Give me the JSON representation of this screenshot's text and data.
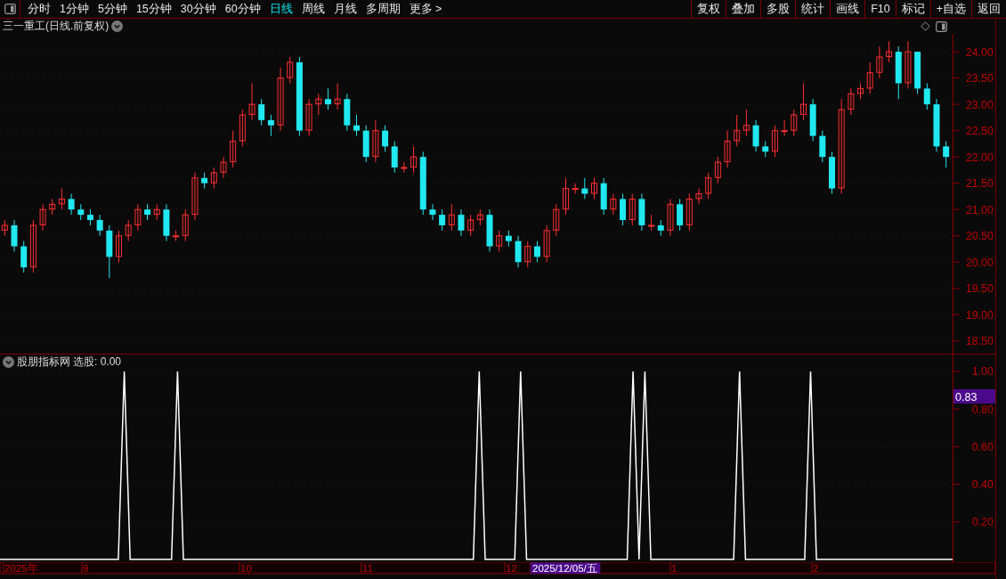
{
  "toolbar": {
    "periods": [
      {
        "label": "分时",
        "selected": false
      },
      {
        "label": "1分钟",
        "selected": false
      },
      {
        "label": "5分钟",
        "selected": false
      },
      {
        "label": "15分钟",
        "selected": false
      },
      {
        "label": "30分钟",
        "selected": false
      },
      {
        "label": "60分钟",
        "selected": false
      },
      {
        "label": "日线",
        "selected": true
      },
      {
        "label": "周线",
        "selected": false
      },
      {
        "label": "月线",
        "selected": false
      },
      {
        "label": "多周期",
        "selected": false
      },
      {
        "label": "更多 >",
        "selected": false
      }
    ],
    "actions": [
      "复权",
      "叠加",
      "多股",
      "统计",
      "画线",
      "F10",
      "标记",
      "+自选",
      "返回"
    ]
  },
  "price_chart": {
    "title": "三一重工(日线.前复权)",
    "chart_data": {
      "type": "candlestick",
      "grid": true,
      "ylim": [
        18.26,
        24.34
      ],
      "yticks": [
        {
          "value": 24,
          "label": "24.00"
        },
        {
          "value": 23.5,
          "label": "23.50"
        },
        {
          "value": 23,
          "label": "23.00"
        },
        {
          "value": 22.5,
          "label": "22.50"
        },
        {
          "value": 22,
          "label": "22.00"
        },
        {
          "value": 21.5,
          "label": "21.50"
        },
        {
          "value": 21,
          "label": "21.00"
        },
        {
          "value": 20.5,
          "label": "20.50"
        },
        {
          "value": 20,
          "label": "20.00"
        },
        {
          "value": 19.5,
          "label": "19.50"
        },
        {
          "value": 19,
          "label": "19.00"
        },
        {
          "value": 18.5,
          "label": "18.50"
        }
      ],
      "ohlc": [
        [
          20.6,
          20.8,
          20.5,
          20.7
        ],
        [
          20.7,
          20.8,
          20.2,
          20.3
        ],
        [
          20.3,
          20.4,
          19.8,
          19.9
        ],
        [
          19.9,
          20.8,
          19.8,
          20.7
        ],
        [
          20.7,
          21.1,
          20.6,
          21.0
        ],
        [
          21.0,
          21.2,
          20.9,
          21.1
        ],
        [
          21.1,
          21.4,
          21.0,
          21.2
        ],
        [
          21.2,
          21.3,
          20.9,
          21.0
        ],
        [
          21.0,
          21.1,
          20.8,
          20.9
        ],
        [
          20.9,
          21.0,
          20.7,
          20.8
        ],
        [
          20.8,
          20.9,
          20.5,
          20.6
        ],
        [
          20.6,
          20.7,
          19.7,
          20.1
        ],
        [
          20.1,
          20.6,
          20.0,
          20.5
        ],
        [
          20.5,
          20.8,
          20.4,
          20.7
        ],
        [
          20.7,
          21.1,
          20.6,
          21.0
        ],
        [
          21.0,
          21.1,
          20.8,
          20.9
        ],
        [
          20.9,
          21.1,
          20.8,
          21.0
        ],
        [
          21.0,
          21.1,
          20.4,
          20.5
        ],
        [
          20.5,
          20.6,
          20.4,
          20.5
        ],
        [
          20.5,
          21.0,
          20.4,
          20.9
        ],
        [
          20.9,
          21.7,
          20.8,
          21.6
        ],
        [
          21.6,
          21.7,
          21.4,
          21.5
        ],
        [
          21.5,
          21.8,
          21.4,
          21.7
        ],
        [
          21.7,
          22.0,
          21.6,
          21.9
        ],
        [
          21.9,
          22.5,
          21.8,
          22.3
        ],
        [
          22.3,
          22.9,
          22.2,
          22.8
        ],
        [
          22.8,
          23.4,
          22.7,
          23.0
        ],
        [
          23.0,
          23.1,
          22.6,
          22.7
        ],
        [
          22.7,
          22.8,
          22.4,
          22.6
        ],
        [
          22.6,
          23.7,
          22.5,
          23.5
        ],
        [
          23.5,
          23.9,
          23.4,
          23.8
        ],
        [
          23.8,
          23.9,
          22.4,
          22.5
        ],
        [
          22.5,
          23.1,
          22.4,
          23.0
        ],
        [
          23.0,
          23.2,
          22.8,
          23.1
        ],
        [
          23.1,
          23.3,
          22.9,
          23.0
        ],
        [
          23.0,
          23.4,
          22.9,
          23.1
        ],
        [
          23.1,
          23.2,
          22.5,
          22.6
        ],
        [
          22.6,
          22.8,
          22.4,
          22.5
        ],
        [
          22.5,
          22.6,
          21.9,
          22.0
        ],
        [
          22.0,
          22.7,
          21.9,
          22.5
        ],
        [
          22.5,
          22.6,
          22.1,
          22.2
        ],
        [
          22.2,
          22.3,
          21.7,
          21.8
        ],
        [
          21.8,
          21.9,
          21.7,
          21.8
        ],
        [
          21.8,
          22.2,
          21.7,
          22.0
        ],
        [
          22.0,
          22.1,
          20.9,
          21.0
        ],
        [
          21.0,
          21.1,
          20.8,
          20.9
        ],
        [
          20.9,
          21.0,
          20.6,
          20.7
        ],
        [
          20.7,
          21.1,
          20.6,
          20.9
        ],
        [
          20.9,
          21.0,
          20.5,
          20.6
        ],
        [
          20.6,
          20.9,
          20.5,
          20.8
        ],
        [
          20.8,
          21.0,
          20.7,
          20.9
        ],
        [
          20.9,
          21.0,
          20.2,
          20.3
        ],
        [
          20.3,
          20.6,
          20.2,
          20.5
        ],
        [
          20.5,
          20.6,
          20.3,
          20.4
        ],
        [
          20.4,
          20.5,
          19.9,
          20.0
        ],
        [
          20.0,
          20.4,
          19.9,
          20.3
        ],
        [
          20.3,
          20.4,
          20.0,
          20.1
        ],
        [
          20.1,
          20.7,
          20.0,
          20.6
        ],
        [
          20.6,
          21.1,
          20.5,
          21.0
        ],
        [
          21.0,
          21.6,
          20.9,
          21.4
        ],
        [
          21.4,
          21.5,
          21.3,
          21.4
        ],
        [
          21.4,
          21.6,
          21.2,
          21.3
        ],
        [
          21.3,
          21.6,
          21.2,
          21.5
        ],
        [
          21.5,
          21.6,
          20.9,
          21.0
        ],
        [
          21.0,
          21.3,
          20.9,
          21.2
        ],
        [
          21.2,
          21.3,
          20.7,
          20.8
        ],
        [
          20.8,
          21.3,
          20.7,
          21.2
        ],
        [
          21.2,
          21.3,
          20.6,
          20.7
        ],
        [
          20.7,
          20.9,
          20.6,
          20.7
        ],
        [
          20.7,
          20.8,
          20.5,
          20.6
        ],
        [
          20.6,
          21.2,
          20.5,
          21.1
        ],
        [
          21.1,
          21.2,
          20.6,
          20.7
        ],
        [
          20.7,
          21.3,
          20.6,
          21.2
        ],
        [
          21.2,
          21.4,
          21.1,
          21.3
        ],
        [
          21.3,
          21.7,
          21.2,
          21.6
        ],
        [
          21.6,
          22.0,
          21.5,
          21.9
        ],
        [
          21.9,
          22.5,
          21.8,
          22.3
        ],
        [
          22.3,
          22.8,
          22.2,
          22.5
        ],
        [
          22.5,
          22.9,
          22.4,
          22.6
        ],
        [
          22.6,
          22.7,
          22.1,
          22.2
        ],
        [
          22.2,
          22.3,
          22.0,
          22.1
        ],
        [
          22.1,
          22.6,
          22.0,
          22.5
        ],
        [
          22.5,
          22.7,
          22.4,
          22.5
        ],
        [
          22.5,
          22.9,
          22.4,
          22.8
        ],
        [
          22.8,
          23.4,
          22.7,
          23.0
        ],
        [
          23.0,
          23.1,
          22.3,
          22.4
        ],
        [
          22.4,
          22.5,
          21.9,
          22.0
        ],
        [
          22.0,
          22.1,
          21.3,
          21.4
        ],
        [
          21.4,
          23.1,
          21.3,
          22.9
        ],
        [
          22.9,
          23.3,
          22.8,
          23.2
        ],
        [
          23.2,
          23.4,
          23.1,
          23.3
        ],
        [
          23.3,
          23.8,
          23.2,
          23.6
        ],
        [
          23.6,
          24.1,
          23.5,
          23.9
        ],
        [
          23.9,
          24.2,
          23.8,
          24.0
        ],
        [
          24.0,
          24.1,
          23.1,
          23.4
        ],
        [
          23.4,
          24.2,
          23.3,
          24.0
        ],
        [
          24.0,
          24.0,
          23.2,
          23.3
        ],
        [
          23.3,
          23.4,
          22.9,
          23.0
        ],
        [
          23.0,
          23.1,
          22.1,
          22.2
        ],
        [
          22.2,
          22.3,
          21.8,
          22.0
        ]
      ]
    }
  },
  "indicator": {
    "title": "股朋指标网",
    "reading": "选股: 0.00",
    "cursor_value": "0.83",
    "chart_data": {
      "type": "line",
      "grid": true,
      "ylim": [
        -0.014,
        1.09
      ],
      "yticks": [
        {
          "value": 0.2,
          "label": "0.20"
        },
        {
          "value": 0.4,
          "label": "0.40"
        },
        {
          "value": 0.6,
          "label": "0.60"
        },
        {
          "value": 0.8,
          "label": "0.80"
        },
        {
          "value": 1,
          "label": "1.00"
        }
      ],
      "series": [
        {
          "color": "#ffffff",
          "values": [
            0,
            0,
            0,
            0,
            0,
            0,
            0,
            0,
            0,
            0,
            0,
            0,
            0,
            0,
            0,
            0,
            0,
            0,
            0,
            0,
            0,
            1,
            0,
            0,
            0,
            0,
            0,
            0,
            0,
            0,
            1,
            0,
            0,
            0,
            0,
            0,
            0,
            0,
            0,
            0,
            0,
            0,
            0,
            0,
            0,
            0,
            0,
            0,
            0,
            0,
            0,
            0,
            0,
            0,
            0,
            0,
            0,
            0,
            0,
            0,
            0,
            0,
            0,
            0,
            0,
            0,
            0,
            0,
            0,
            0,
            0,
            0,
            0,
            0,
            0,
            0,
            0,
            0,
            0,
            0,
            0,
            1,
            0,
            0,
            0,
            0,
            0,
            0,
            1,
            0,
            0,
            0,
            0,
            0,
            0,
            0,
            0,
            0,
            0,
            0,
            0,
            0,
            0,
            0,
            0,
            0,
            0,
            1,
            0,
            1,
            0,
            0,
            0,
            0,
            0,
            0,
            0,
            0,
            0,
            0,
            0,
            0,
            0,
            0,
            0,
            1,
            0,
            0,
            0,
            0,
            0,
            0,
            0,
            0,
            0,
            0,
            0,
            1,
            0,
            0,
            0,
            0,
            0,
            0,
            0,
            0,
            0,
            0,
            0,
            0,
            0,
            0,
            0,
            0,
            0,
            0,
            0,
            0,
            0,
            0,
            0,
            0
          ]
        }
      ]
    }
  },
  "date_axis": [
    {
      "label": "2025年",
      "selected": false
    },
    {
      "label": "9",
      "selected": false
    },
    {
      "label": "10",
      "selected": false
    },
    {
      "label": "11",
      "selected": false
    },
    {
      "label": "12",
      "selected": false
    },
    {
      "label": "2025/12/05/五",
      "selected": true
    },
    {
      "label": "1",
      "selected": false
    },
    {
      "label": "2",
      "selected": false
    }
  ]
}
